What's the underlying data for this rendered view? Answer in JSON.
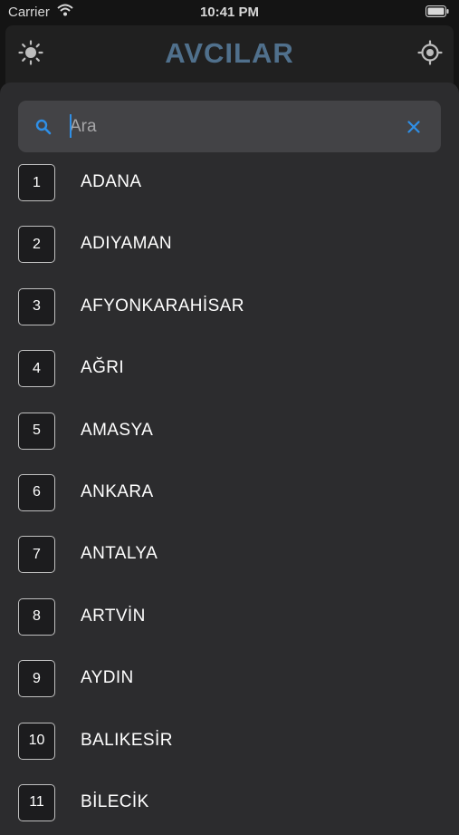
{
  "status_bar": {
    "carrier": "Carrier",
    "time": "10:41 PM"
  },
  "header": {
    "title": "AVCILAR"
  },
  "search": {
    "placeholder": "Ara",
    "value": ""
  },
  "cities": [
    {
      "plate": "1",
      "name": "ADANA"
    },
    {
      "plate": "2",
      "name": "ADIYAMAN"
    },
    {
      "plate": "3",
      "name": "AFYONKARAHİSAR"
    },
    {
      "plate": "4",
      "name": "AĞRI"
    },
    {
      "plate": "5",
      "name": "AMASYA"
    },
    {
      "plate": "6",
      "name": "ANKARA"
    },
    {
      "plate": "7",
      "name": "ANTALYA"
    },
    {
      "plate": "8",
      "name": "ARTVİN"
    },
    {
      "plate": "9",
      "name": "AYDIN"
    },
    {
      "plate": "10",
      "name": "BALIKESİR"
    },
    {
      "plate": "11",
      "name": "BİLECİK"
    }
  ],
  "colors": {
    "title": "#50708c",
    "accent": "#2f8fe6",
    "sheet": "#2c2c2e"
  }
}
